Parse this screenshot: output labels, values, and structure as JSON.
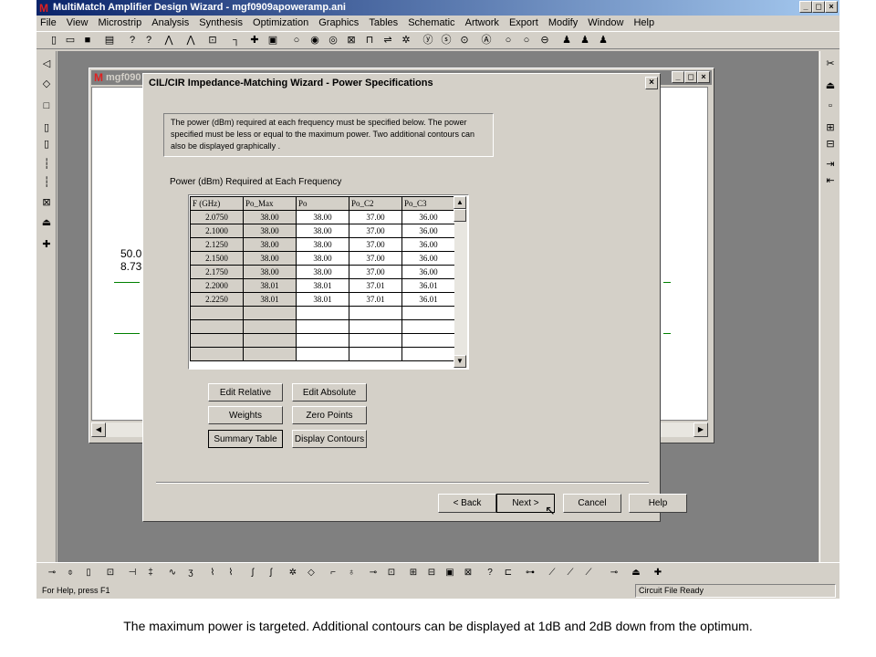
{
  "app": {
    "title": "MultiMatch Amplifier Design Wizard - mgf0909apoweramp.ani",
    "logo": "M",
    "window_buttons": [
      "_",
      "◻",
      "×"
    ],
    "colors": {
      "titlebar": "#0a246a",
      "face": "#d4d0c8",
      "mdi": "#808080"
    }
  },
  "menubar": {
    "items": [
      "File",
      "View",
      "Microstrip",
      "Analysis",
      "Synthesis",
      "Optimization",
      "Graphics",
      "Tables",
      "Schematic",
      "Artwork",
      "Export",
      "Modify",
      "Window",
      "Help"
    ]
  },
  "toolbar": {
    "icons": [
      "new-file-icon",
      "open-folder-icon",
      "save-icon",
      "print-icon",
      "help-icon",
      "context-help-icon",
      "zoom-in-icon",
      "zoom-out-icon",
      "fit-icon",
      "wire-icon",
      "cross-icon",
      "box-icon",
      "circle-icon",
      "target-icon",
      "ring-icon",
      "box-x-icon",
      "bracket-icon",
      "equals-icon",
      "gear-icon",
      "y-icon",
      "s-icon",
      "dot-icon",
      "a-icon",
      "o-icon",
      "q-icon",
      "minus-circle-icon",
      "person-icon",
      "people-icon",
      "group-icon"
    ]
  },
  "child": {
    "title": "mgf090",
    "canvas_text": [
      "50.0",
      "8.73"
    ]
  },
  "dialog": {
    "title": "CIL/CIR Impedance-Matching Wizard - Power Specifications",
    "close": "×",
    "instructions": "The power (dBm) required at each frequency must be specified below. The power specified must be less or equal to the maximum power. Two additional contours can also be displayed graphically .",
    "grid_label": "Power (dBm) Required at Each Frequency",
    "grid": {
      "headers": [
        "F (GHz)",
        "Po_Max",
        "Po",
        "Po_C2",
        "Po_C3"
      ],
      "rows": [
        [
          "2.0750",
          "38.00",
          "38.00",
          "37.00",
          "36.00"
        ],
        [
          "2.1000",
          "38.00",
          "38.00",
          "37.00",
          "36.00"
        ],
        [
          "2.1250",
          "38.00",
          "38.00",
          "37.00",
          "36.00"
        ],
        [
          "2.1500",
          "38.00",
          "38.00",
          "37.00",
          "36.00"
        ],
        [
          "2.1750",
          "38.00",
          "38.00",
          "37.00",
          "36.00"
        ],
        [
          "2.2000",
          "38.01",
          "38.01",
          "37.01",
          "36.01"
        ],
        [
          "2.2250",
          "38.01",
          "38.01",
          "37.01",
          "36.01"
        ],
        [
          "",
          "",
          "",
          "",
          ""
        ],
        [
          "",
          "",
          "",
          "",
          ""
        ],
        [
          "",
          "",
          "",
          "",
          ""
        ],
        [
          "",
          "",
          "",
          "",
          ""
        ]
      ]
    },
    "buttons": {
      "edit_relative": "Edit Relative",
      "edit_absolute": "Edit Absolute",
      "weights": "Weights",
      "zero_points": "Zero Points",
      "summary_table": "Summary Table",
      "display_contours": "Display Contours",
      "back": "< Back",
      "next": "Next >",
      "cancel": "Cancel",
      "help": "Help"
    }
  },
  "status": {
    "left": "For Help, press F1",
    "right": "Circuit File Ready"
  },
  "caption": "The maximum power is targeted. Additional contours can be displayed at 1dB and 2dB down from the optimum."
}
